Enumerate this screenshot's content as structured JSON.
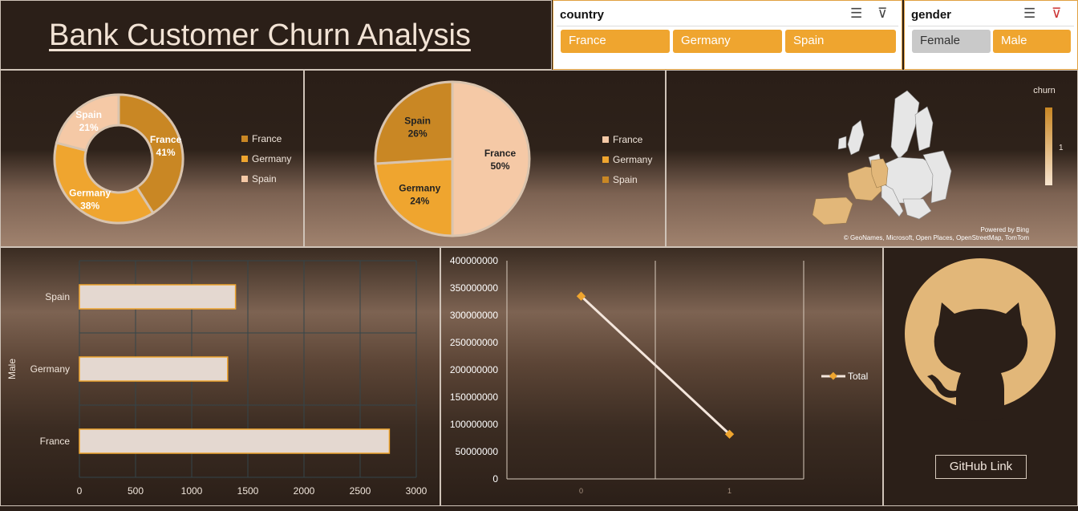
{
  "title": "Bank Customer Churn Analysis",
  "slicers": {
    "country": {
      "label": "country",
      "options": [
        "France",
        "Germany",
        "Spain"
      ]
    },
    "gender": {
      "label": "gender",
      "options": [
        "Female",
        "Male"
      ],
      "unselected": [
        "Female"
      ]
    }
  },
  "colors": {
    "france": "#f5c9a6",
    "germany": "#efa52f",
    "spain": "#c98724",
    "donut_france": "#c98724",
    "donut_spain": "#f5c9a6"
  },
  "map": {
    "legend_title": "churn",
    "legend_value": "1",
    "credit_line1": "Powered by Bing",
    "credit_line2": "© GeoNames, Microsoft, Open Places, OpenStreetMap, TomTom"
  },
  "chart_data": [
    {
      "type": "pie",
      "variant": "donut",
      "categories": [
        "France",
        "Germany",
        "Spain"
      ],
      "values": [
        41,
        38,
        21
      ],
      "labels": [
        "41%",
        "38%",
        "21%"
      ],
      "legend": [
        "France",
        "Germany",
        "Spain"
      ]
    },
    {
      "type": "pie",
      "categories": [
        "France",
        "Germany",
        "Spain"
      ],
      "values": [
        50,
        24,
        26
      ],
      "labels": [
        "50%",
        "24%",
        "26%"
      ],
      "legend": [
        "France",
        "Germany",
        "Spain"
      ]
    },
    {
      "type": "bar",
      "orientation": "horizontal",
      "ylabel": "Male",
      "categories": [
        "Spain",
        "Germany",
        "France"
      ],
      "values": [
        1390,
        1320,
        2760
      ],
      "xlim": [
        0,
        3000
      ],
      "xticks": [
        "0",
        "500",
        "1000",
        "1500",
        "2000",
        "2500",
        "3000"
      ]
    },
    {
      "type": "line",
      "x": [
        "0",
        "1"
      ],
      "series": [
        {
          "name": "Total",
          "values": [
            335000000,
            82000000
          ]
        }
      ],
      "ylim": [
        0,
        400000000
      ],
      "yticks": [
        "400000000",
        "350000000",
        "300000000",
        "250000000",
        "200000000",
        "150000000",
        "100000000",
        "50000000",
        "0"
      ]
    }
  ],
  "github": {
    "link_label": "GitHub Link"
  }
}
